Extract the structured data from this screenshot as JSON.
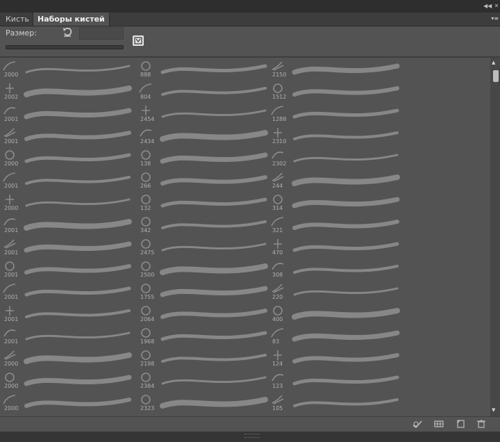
{
  "tabs": [
    {
      "label": "Кисть",
      "active": false
    },
    {
      "label": "Наборы кистей",
      "active": true
    }
  ],
  "size": {
    "label": "Размер:",
    "value": ""
  },
  "icons": {
    "collapse": "double-chevron-left-icon",
    "close": "close-icon",
    "panel_menu": "panel-menu-icon",
    "reset": "reset-icon",
    "brush_toggle": "brush-toggle-icon",
    "bottom": [
      "toggle-brush-panel-icon",
      "brush-grid-icon",
      "new-preset-icon",
      "trash-icon"
    ]
  },
  "colors": {
    "panel_bg": "#535353",
    "dark_strip": "#2e2e2e",
    "text": "#d6d6d6"
  },
  "columns": [
    {
      "numbers": [
        "2000",
        "2002",
        "2001",
        "2001",
        "2000",
        "2001",
        "2000",
        "2001",
        "2001",
        "2001",
        "2001",
        "2001",
        "2001",
        "2000",
        "2000",
        "2000"
      ]
    },
    {
      "numbers": [
        "888",
        "804",
        "2454",
        "2434",
        "138",
        "266",
        "132",
        "342",
        "2475",
        "2500",
        "1755",
        "2064",
        "1968",
        "2198",
        "2384",
        "2323"
      ]
    },
    {
      "numbers": [
        "2150",
        "1512",
        "1288",
        "2310",
        "2302",
        "244",
        "314",
        "321",
        "470",
        "308",
        "220",
        "400",
        "83",
        "124",
        "123",
        "105"
      ]
    }
  ]
}
